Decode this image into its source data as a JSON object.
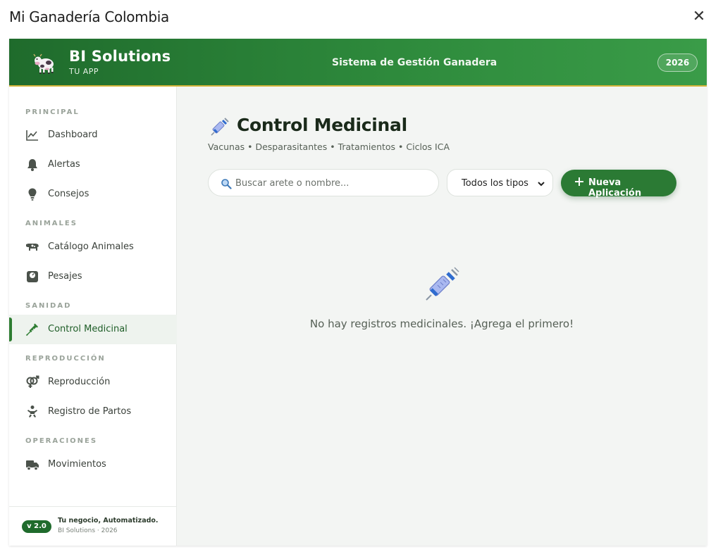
{
  "window": {
    "title": "Mi Ganadería Colombia",
    "close_icon": "close-icon"
  },
  "header": {
    "brand_name": "BI Solutions",
    "brand_sub": "TU APP",
    "title": "Sistema de Gestión Ganadera",
    "year": "2026",
    "brand_icon": "cow-icon",
    "colors": {
      "header_start": "#1f6b2c",
      "header_end": "#3a9c48",
      "accent_line": "#d4b43a"
    }
  },
  "sidebar": {
    "sections": [
      {
        "label": "PRINCIPAL"
      },
      {
        "label": "ANIMALES"
      },
      {
        "label": "SANIDAD"
      },
      {
        "label": "REPRODUCCIÓN"
      },
      {
        "label": "OPERACIONES"
      }
    ],
    "items": [
      {
        "label": "Dashboard",
        "icon": "chart-line-icon",
        "active": false
      },
      {
        "label": "Alertas",
        "icon": "bell-icon",
        "active": false
      },
      {
        "label": "Consejos",
        "icon": "lightbulb-icon",
        "active": false
      },
      {
        "label": "Catálogo Animales",
        "icon": "cow-icon",
        "active": false
      },
      {
        "label": "Pesajes",
        "icon": "weight-scale-icon",
        "active": false
      },
      {
        "label": "Control Medicinal",
        "icon": "syringe-icon",
        "active": true
      },
      {
        "label": "Reproducción",
        "icon": "venus-mars-icon",
        "active": false
      },
      {
        "label": "Registro de Partos",
        "icon": "baby-icon",
        "active": false
      },
      {
        "label": "Movimientos",
        "icon": "truck-icon",
        "active": false
      }
    ],
    "footer": {
      "version": "v 2.0",
      "tagline": "Tu negocio, Automatizado.",
      "copyright": "BI Solutions · 2026"
    }
  },
  "main": {
    "title": "Control Medicinal",
    "subtitle": "Vacunas • Desparasitantes • Tratamientos • Ciclos ICA",
    "title_icon": "syringe-icon",
    "search": {
      "placeholder": "Buscar arete o nombre...",
      "value": ""
    },
    "type_filter": {
      "selected": "Todos los tipos"
    },
    "new_button_label": "Nueva Aplicación",
    "empty_state": {
      "icon": "syringe-icon",
      "text": "No hay registros medicinales. ¡Agrega el primero!"
    },
    "colors": {
      "primary": "#2b7a34"
    }
  }
}
